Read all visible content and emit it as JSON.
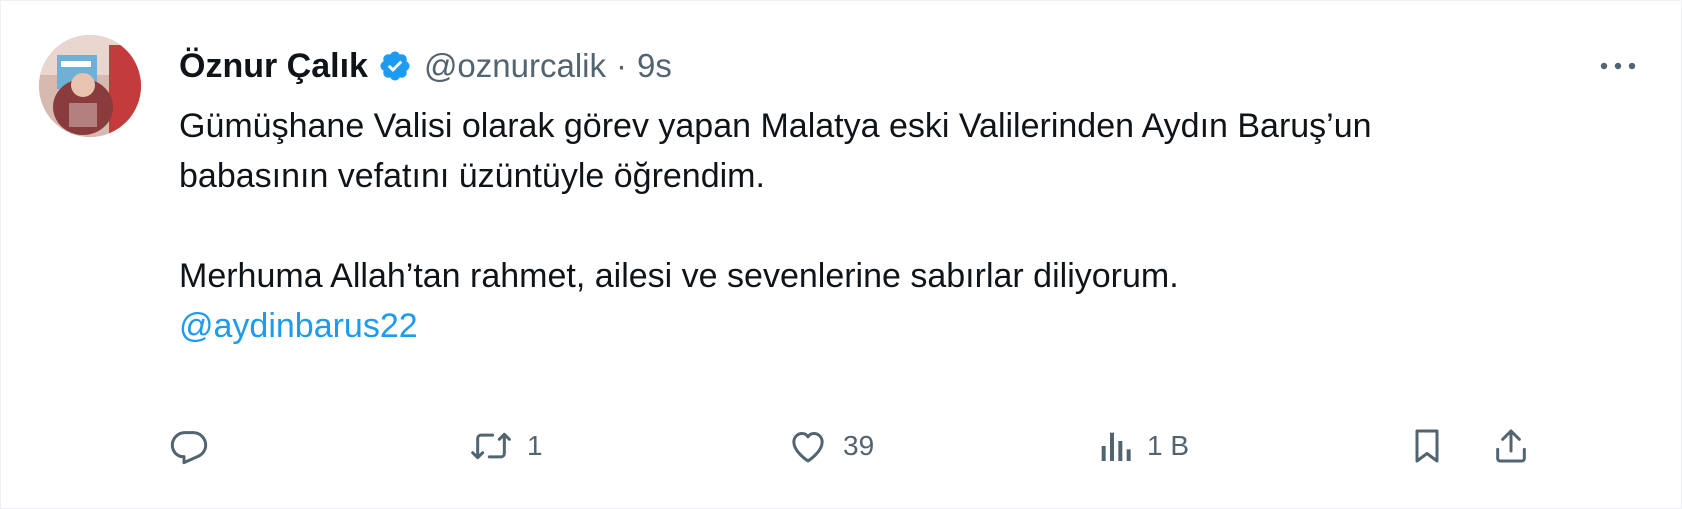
{
  "tweet": {
    "author": {
      "name": "Öznur Çalık",
      "handle": "@oznurcalik",
      "verified": true
    },
    "separator": "·",
    "time": "9s",
    "text": {
      "line1": "Gümüşhane Valisi olarak görev yapan Malatya eski Valilerinden Aydın Baruş’un",
      "line2": "babasının vefatını üzüntüyle öğrendim.",
      "line3": "Merhuma Allah’tan rahmet, ailesi ve sevenlerine sabırlar diliyorum.",
      "mention": "@aydinbarus22"
    },
    "actions": {
      "reply_count": "",
      "retweet_count": "1",
      "like_count": "39",
      "views_count": "1 B"
    }
  },
  "colors": {
    "accent": "#1d9bf0",
    "text_primary": "#0f1419",
    "text_secondary": "#536471"
  },
  "icons": [
    "verified-badge-icon",
    "more-icon",
    "reply-icon",
    "retweet-icon",
    "like-icon",
    "views-icon",
    "bookmark-icon",
    "share-icon"
  ]
}
